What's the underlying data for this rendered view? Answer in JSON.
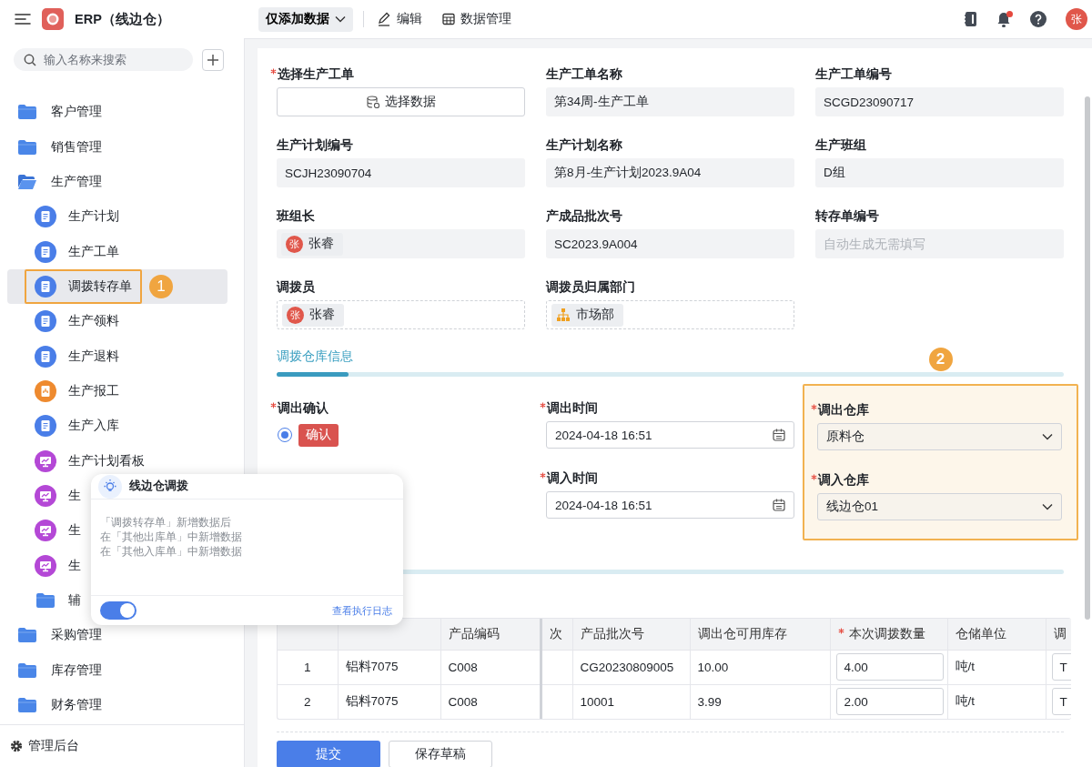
{
  "app": {
    "title": "ERP（线边仓）"
  },
  "sidebar": {
    "search": {
      "placeholder": "输入名称来搜索"
    },
    "items": [
      {
        "label": "客户管理",
        "kind": "folder",
        "expanded": false,
        "selected": false
      },
      {
        "label": "销售管理",
        "kind": "folder",
        "expanded": false,
        "selected": false
      },
      {
        "label": "生产管理",
        "kind": "folder",
        "expanded": true,
        "selected": false,
        "children": [
          {
            "label": "生产计划",
            "kind": "form",
            "selected": false
          },
          {
            "label": "生产工单",
            "kind": "form",
            "selected": false
          },
          {
            "label": "调拨转存单",
            "kind": "form",
            "selected": true,
            "annotation": "1"
          },
          {
            "label": "生产领料",
            "kind": "form",
            "selected": false
          },
          {
            "label": "生产退料",
            "kind": "form",
            "selected": false
          },
          {
            "label": "生产报工",
            "kind": "report",
            "selected": false
          },
          {
            "label": "生产入库",
            "kind": "form",
            "selected": false
          },
          {
            "label": "生产计划看板",
            "kind": "board",
            "selected": false
          },
          {
            "label": "生",
            "kind": "board",
            "selected": false
          },
          {
            "label": "生",
            "kind": "board",
            "selected": false
          },
          {
            "label": "生",
            "kind": "board",
            "selected": false
          },
          {
            "label": "辅",
            "kind": "folder",
            "expanded": false,
            "selected": false
          }
        ]
      },
      {
        "label": "采购管理",
        "kind": "folder",
        "expanded": false,
        "selected": false
      },
      {
        "label": "库存管理",
        "kind": "folder",
        "expanded": false,
        "selected": false
      },
      {
        "label": "财务管理",
        "kind": "folder",
        "expanded": false,
        "selected": false
      }
    ],
    "footer": "管理后台"
  },
  "toolbar": {
    "mode_button": "仅添加数据",
    "actions": [
      {
        "label": "编辑",
        "kind": "edit"
      },
      {
        "label": "数据管理",
        "kind": "table"
      }
    ],
    "unread": true,
    "avatar": "张"
  },
  "form": {
    "fields": [
      {
        "label": "选择生产工单",
        "required": true,
        "kind": "picker",
        "value": "选择数据"
      },
      {
        "label": "生产工单名称",
        "required": false,
        "kind": "text",
        "value": "第34周-生产工单"
      },
      {
        "label": "生产工单编号",
        "required": false,
        "kind": "text",
        "value": "SCGD23090717"
      },
      {
        "label": "生产计划编号",
        "required": false,
        "kind": "text",
        "value": "SCJH23090704"
      },
      {
        "label": "生产计划名称",
        "required": false,
        "kind": "text",
        "value": "第8月-生产计划2023.9A04"
      },
      {
        "label": "生产班组",
        "required": false,
        "kind": "text",
        "value": "D组"
      },
      {
        "label": "班组长",
        "required": false,
        "kind": "person",
        "editable": false,
        "avatar": "张",
        "value": "张睿"
      },
      {
        "label": "产成品批次号",
        "required": false,
        "kind": "text",
        "value": "SC2023.9A004"
      },
      {
        "label": "转存单编号",
        "required": false,
        "kind": "auto",
        "placeholder": "自动生成无需填写"
      },
      {
        "label": "调拨员",
        "required": false,
        "kind": "person",
        "editable": true,
        "avatar": "张",
        "value": "张睿"
      },
      {
        "label": "调拨员归属部门",
        "required": false,
        "kind": "department",
        "editable": true,
        "value": "市场部"
      }
    ],
    "section": {
      "title": "调拨仓库信息",
      "columns": [
        {
          "highlighted": false,
          "fields": [
            {
              "label": "调出确认",
              "required": true,
              "kind": "confirm",
              "selected": true,
              "value": "确认"
            }
          ]
        },
        {
          "highlighted": false,
          "fields": [
            {
              "label": "调出时间",
              "required": true,
              "kind": "datetime",
              "value": "2024-04-18 16:51"
            },
            {
              "label": "调入时间",
              "required": true,
              "kind": "datetime",
              "value": "2024-04-18 16:51"
            }
          ]
        },
        {
          "highlighted": true,
          "annotation": "2",
          "fields": [
            {
              "label": "调出仓库",
              "required": true,
              "kind": "select",
              "value": "原料仓"
            },
            {
              "label": "调入仓库",
              "required": true,
              "kind": "select",
              "value": "线边仓01"
            }
          ]
        }
      ]
    },
    "table": {
      "columns": [
        {
          "required": false
        },
        {
          "required": false
        },
        {
          "label": "产品编码",
          "required": false
        },
        {
          "label": "次",
          "required": false
        },
        {
          "label": "产品批次号",
          "required": false
        },
        {
          "label": "调出仓可用库存",
          "required": false
        },
        {
          "label": "本次调拨数量",
          "required": true
        },
        {
          "label": "仓储单位",
          "required": false
        },
        {
          "label": "调",
          "required": false
        }
      ],
      "rows": [
        {
          "index": "1",
          "column_2": "铝料7075",
          "product_code": "C008",
          "batch_no": "CG20230809005",
          "stock": "10.00",
          "quantity": "4.00",
          "unit": "吨/t",
          "column_9": "T"
        },
        {
          "index": "2",
          "column_2": "铝料7075",
          "product_code": "C008",
          "batch_no": "10001",
          "stock": "3.99",
          "quantity": "2.00",
          "unit": "吨/t",
          "column_9": "T"
        }
      ]
    },
    "buttons": [
      {
        "label": "提交",
        "kind": "primary"
      },
      {
        "label": "保存草稿",
        "kind": "secondary"
      }
    ]
  },
  "popup": {
    "title": "线边仓调拨",
    "lines": [
      "「调拨转存单」新增数据后",
      "在「其他出库单」中新增数据",
      "在「其他入库单」中新增数据"
    ],
    "enabled": true,
    "link": "查看执行日志"
  }
}
